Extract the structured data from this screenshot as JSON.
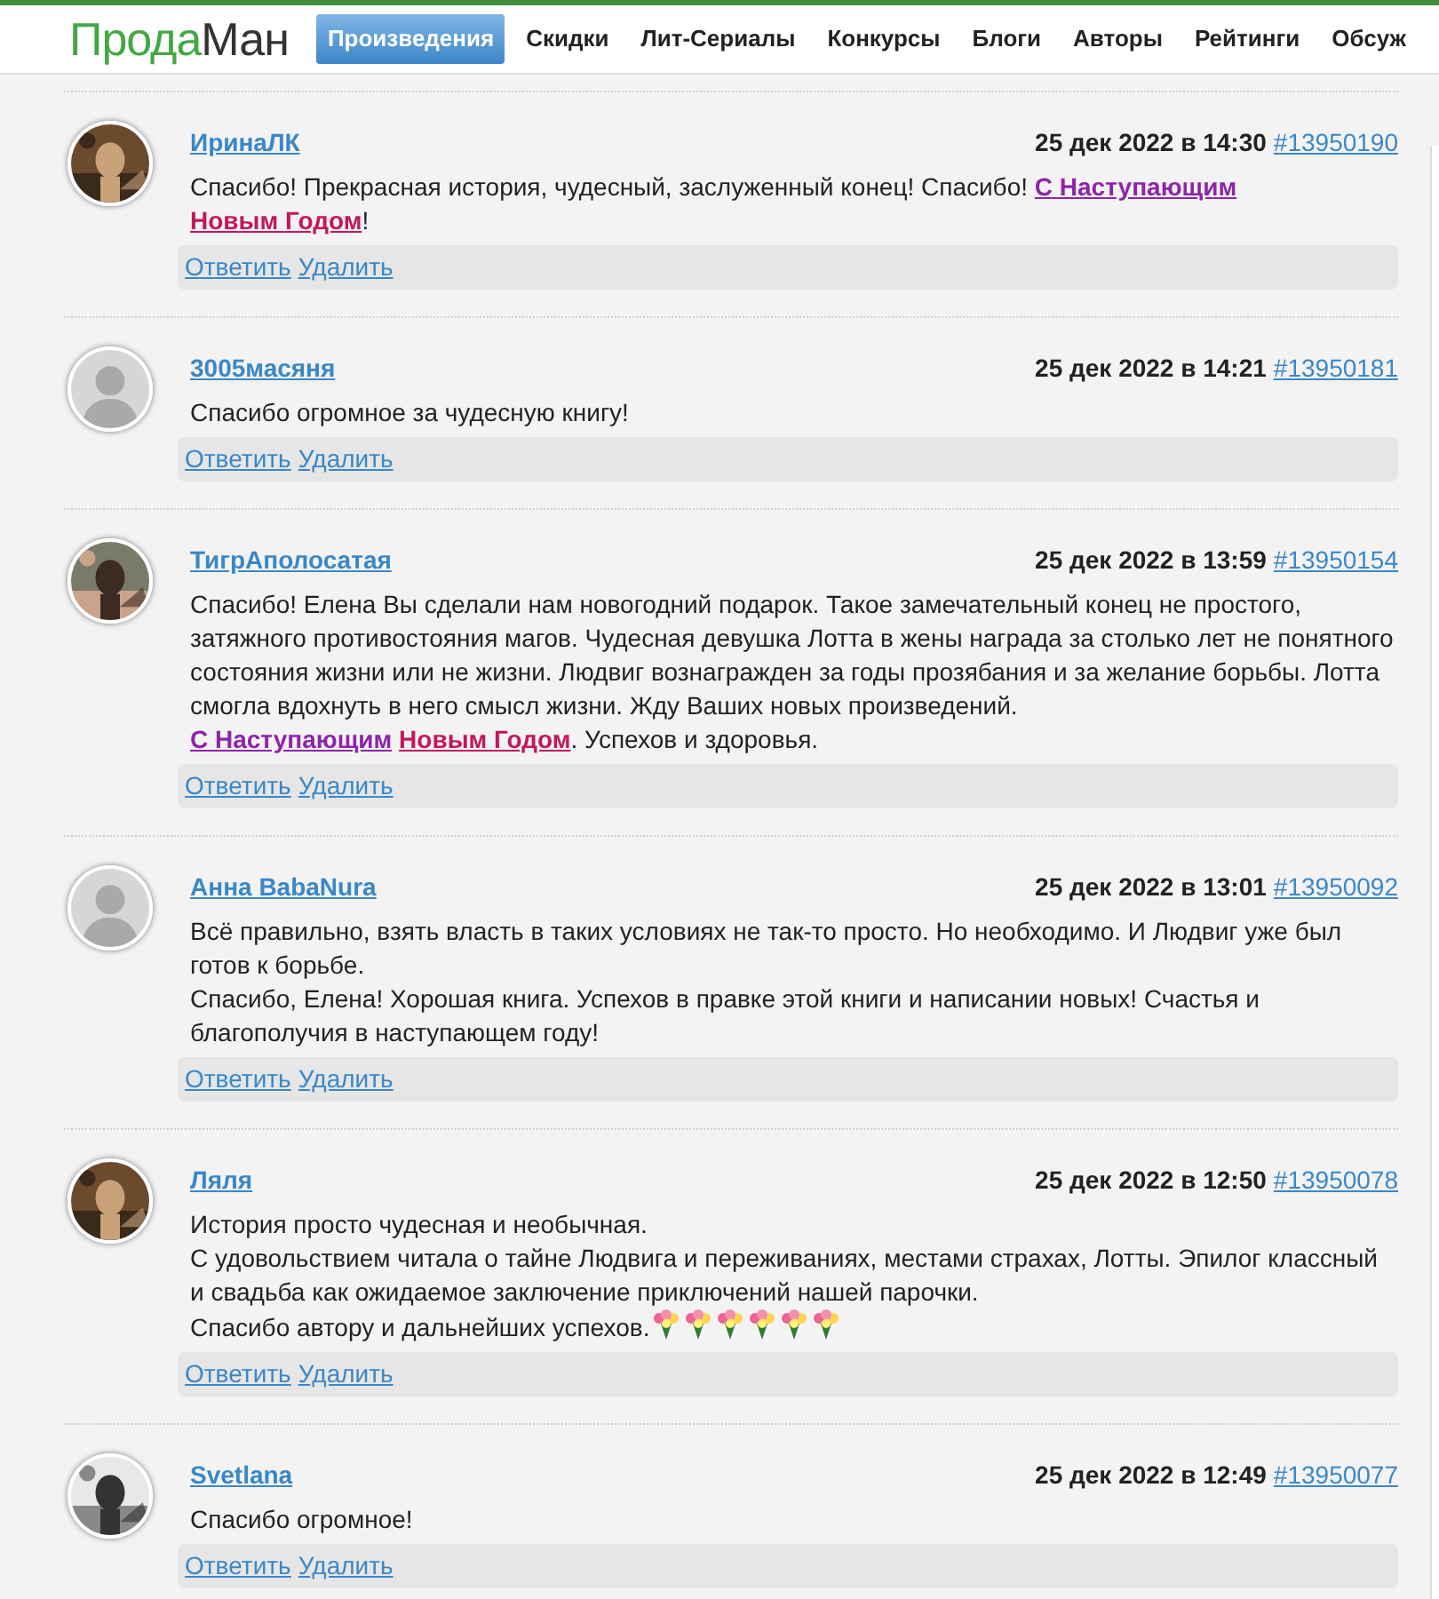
{
  "logo": {
    "part_1": "Прода",
    "part_2": "Ман"
  },
  "nav": [
    {
      "label": "Произведения",
      "selected": true
    },
    {
      "label": "Скидки",
      "selected": false
    },
    {
      "label": "Лит-Сериалы",
      "selected": false
    },
    {
      "label": "Конкурсы",
      "selected": false
    },
    {
      "label": "Блоги",
      "selected": false
    },
    {
      "label": "Авторы",
      "selected": false
    },
    {
      "label": "Рейтинги",
      "selected": false
    },
    {
      "label": "Обсуж",
      "selected": false
    }
  ],
  "comments": [
    {
      "author": "ИринаЛК",
      "avatar": {
        "kind": "picture"
      },
      "date": "25 дек 2022 в 14:30",
      "id": "#13950190",
      "paragraphs": [
        [
          {
            "kind": "text",
            "text": "Спасибо! Прекрасная история, чудесный, заслуженный конец! Спасибо! "
          },
          {
            "kind": "link",
            "text": "С Наступающим",
            "color": "#8e24aa"
          },
          {
            "kind": "link",
            "text": "Новым Годом",
            "color": "#c2185b"
          },
          {
            "kind": "text",
            "text": "!"
          }
        ]
      ],
      "actions": [
        "Ответить",
        "Удалить"
      ]
    },
    {
      "author": "3005масяня",
      "avatar": {
        "kind": "silhouette"
      },
      "date": "25 дек 2022 в 14:21",
      "id": "#13950181",
      "paragraphs": [
        [
          {
            "kind": "text",
            "text": "Спасибо огромное за чудесную книгу!"
          }
        ]
      ],
      "actions": [
        "Ответить",
        "Удалить"
      ]
    },
    {
      "author": "ТигрАполосатая",
      "avatar": {
        "kind": "picture"
      },
      "date": "25 дек 2022 в 13:59",
      "id": "#13950154",
      "paragraphs": [
        [
          {
            "kind": "text",
            "text": "Спасибо! Елена Вы сделали нам новогодний подарок. Такое замечательный конец не простого, затяжного противостояния магов. Чудесная девушка Лотта в жены награда за столько лет не понятного состояния жизни или не жизни. Людвиг вознагражден за годы прозябания и за желание борьбы. Лотта смогла вдохнуть в него смысл жизни. Жду Ваших новых произведений."
          }
        ],
        [
          {
            "kind": "link",
            "text": "С Наступающим",
            "color": "#8e24aa"
          },
          {
            "kind": "link",
            "text": "Новым Годом",
            "color": "#c2185b"
          },
          {
            "kind": "text",
            "text": ". Успехов и здоровья."
          }
        ]
      ],
      "actions": [
        "Ответить",
        "Удалить"
      ]
    },
    {
      "author": "Анна BabaNura",
      "avatar": {
        "kind": "silhouette"
      },
      "date": "25 дек 2022 в 13:01",
      "id": "#13950092",
      "paragraphs": [
        [
          {
            "kind": "text",
            "text": "Всё правильно, взять власть в таких условиях не так-то просто. Но необходимо. И Людвиг уже был готов к борьбе."
          }
        ],
        [
          {
            "kind": "text",
            "text": "Спасибо, Елена! Хорошая книга. Успехов в правке этой книги и написании новых! Счастья и благополучия в наступающем году!"
          }
        ]
      ],
      "actions": [
        "Ответить",
        "Удалить"
      ]
    },
    {
      "author": "Ляля",
      "avatar": {
        "kind": "picture"
      },
      "date": "25 дек 2022 в 12:50",
      "id": "#13950078",
      "paragraphs": [
        [
          {
            "kind": "text",
            "text": "История просто чудесная и необычная."
          }
        ],
        [
          {
            "kind": "text",
            "text": "С удовольствием читала о тайне Людвига и переживаниях, местами страхах, Лотты. Эпилог классный и свадьба как ожидаемое заключение приключений нашей парочки."
          }
        ],
        [
          {
            "kind": "text",
            "text": "Спасибо автору и дальнейших успехов."
          },
          {
            "kind": "flower"
          },
          {
            "kind": "flower"
          },
          {
            "kind": "flower"
          },
          {
            "kind": "flower"
          },
          {
            "kind": "flower"
          },
          {
            "kind": "flower"
          }
        ]
      ],
      "actions": [
        "Ответить",
        "Удалить"
      ]
    },
    {
      "author": "Svetlana",
      "avatar": {
        "kind": "picture"
      },
      "date": "25 дек 2022 в 12:49",
      "id": "#13950077",
      "paragraphs": [
        [
          {
            "kind": "text",
            "text": "Спасибо огромное!"
          }
        ]
      ],
      "actions": [
        "Ответить",
        "Удалить"
      ]
    }
  ]
}
